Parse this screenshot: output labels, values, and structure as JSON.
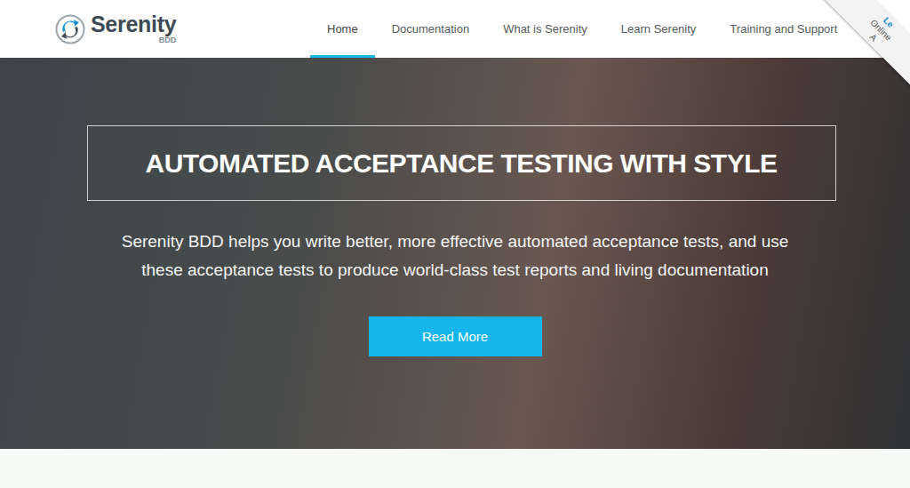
{
  "logo": {
    "name": "Serenity",
    "sub": "BDD"
  },
  "nav": [
    {
      "label": "Home",
      "selected": true
    },
    {
      "label": "Documentation",
      "selected": false
    },
    {
      "label": "What is Serenity",
      "selected": false
    },
    {
      "label": "Learn Serenity",
      "selected": false
    },
    {
      "label": "Training and Support",
      "selected": false
    }
  ],
  "ribbon": {
    "lines": [
      "Le",
      "Online",
      "A"
    ]
  },
  "hero": {
    "title": "AUTOMATED ACCEPTANCE TESTING WITH STYLE",
    "subtitle": "Serenity BDD helps you write better, more effective automated acceptance tests, and use these acceptance tests to produce world-class test reports and living documentation",
    "button": "Read More"
  }
}
